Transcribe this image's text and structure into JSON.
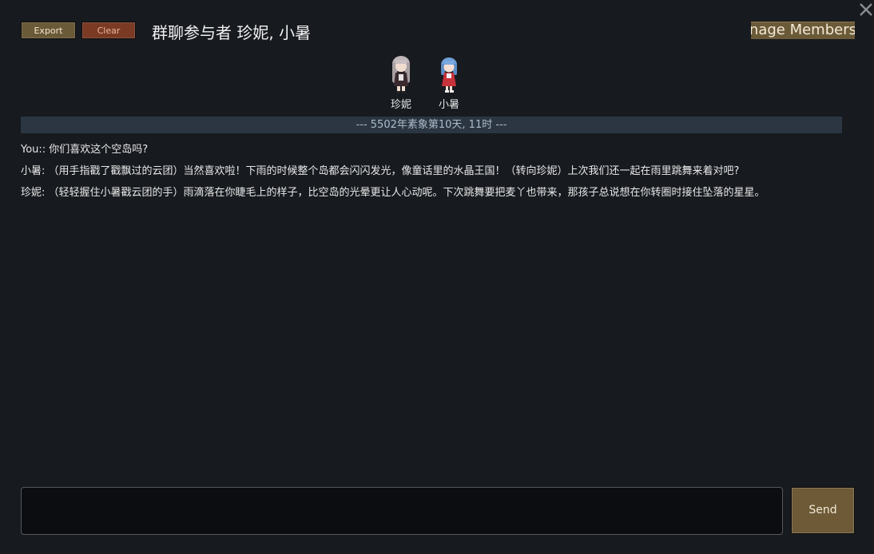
{
  "toolbar": {
    "export_label": "Export",
    "clear_label": "Clear",
    "manage_label": "Manage Members"
  },
  "header": {
    "title": "群聊参与者 珍妮, 小暑"
  },
  "members": [
    {
      "name": "珍妮",
      "avatar_icon": "jenny-portrait-icon"
    },
    {
      "name": "小暑",
      "avatar_icon": "xiaoshu-portrait-icon"
    }
  ],
  "chat": {
    "date_divider": "--- 5502年素象第10天, 11时 ---",
    "messages": [
      {
        "text": "You:: 你们喜欢这个空岛吗?"
      },
      {
        "text": "小暑: （用手指戳了戳飘过的云团）当然喜欢啦！下雨的时候整个岛都会闪闪发光，像童话里的水晶王国！（转向珍妮）上次我们还一起在雨里跳舞来着对吧?"
      },
      {
        "text": "珍妮: （轻轻握住小暑戳云团的手）雨滴落在你睫毛上的样子，比空岛的光晕更让人心动呢。下次跳舞要把麦丫也带来，那孩子总说想在你转圈时接住坠落的星星。"
      }
    ]
  },
  "composer": {
    "input_value": "",
    "send_label": "Send"
  },
  "colors": {
    "background": "#171a1f",
    "button_brown": "#6b5a38",
    "button_red": "#7a3a24",
    "date_bar": "#2b3642"
  }
}
